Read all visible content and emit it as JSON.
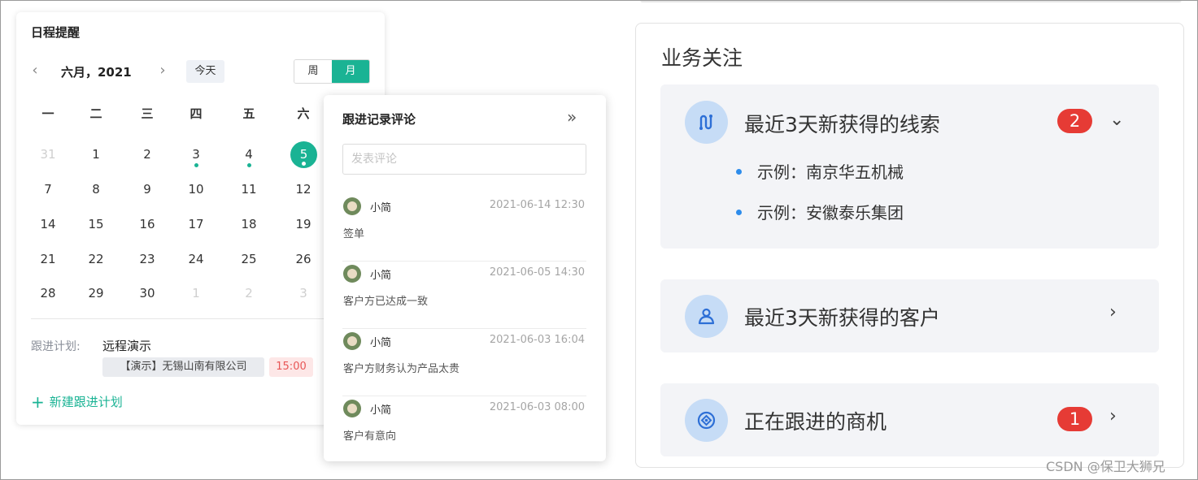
{
  "calendar": {
    "title": "日程提醒",
    "month_label": "六月，2021",
    "today_label": "今天",
    "view_week": "周",
    "view_month": "月",
    "weekdays": [
      "一",
      "二",
      "三",
      "四",
      "五",
      "六"
    ],
    "rows": [
      [
        "31",
        "1",
        "2",
        "3",
        "4",
        "5"
      ],
      [
        "7",
        "8",
        "9",
        "10",
        "11",
        "12"
      ],
      [
        "14",
        "15",
        "16",
        "17",
        "18",
        "19"
      ],
      [
        "21",
        "22",
        "23",
        "24",
        "25",
        "26"
      ],
      [
        "28",
        "29",
        "30",
        "1",
        "2",
        "3"
      ]
    ],
    "selected_day": "5",
    "plan_label": "跟进计划:",
    "plan_title": "远程演示",
    "plan_company": "【演示】无锡山南有限公司",
    "plan_time": "15:00",
    "new_plan": "新建跟进计划"
  },
  "comments": {
    "title": "跟进记录评论",
    "placeholder": "发表评论",
    "items": [
      {
        "user": "小简",
        "time": "2021-06-14 12:30",
        "text": "签单"
      },
      {
        "user": "小简",
        "time": "2021-06-05 14:30",
        "text": "客户方已达成一致"
      },
      {
        "user": "小简",
        "time": "2021-06-03 16:04",
        "text": "客户方财务认为产品太贵"
      },
      {
        "user": "小简",
        "time": "2021-06-03 08:00",
        "text": "客户有意向"
      }
    ]
  },
  "business": {
    "title": "业务关注",
    "panels": [
      {
        "title": "最近3天新获得的线索",
        "badge": "2",
        "items": [
          "示例：南京华五机械",
          "示例：安徽泰乐集团"
        ]
      },
      {
        "title": "最近3天新获得的客户"
      },
      {
        "title": "正在跟进的商机",
        "badge": "1"
      }
    ]
  },
  "watermark": "CSDN @保卫大狮兄",
  "colors": {
    "accent": "#1ab394",
    "badge": "#e63b35",
    "bullet": "#2d8ceb"
  }
}
